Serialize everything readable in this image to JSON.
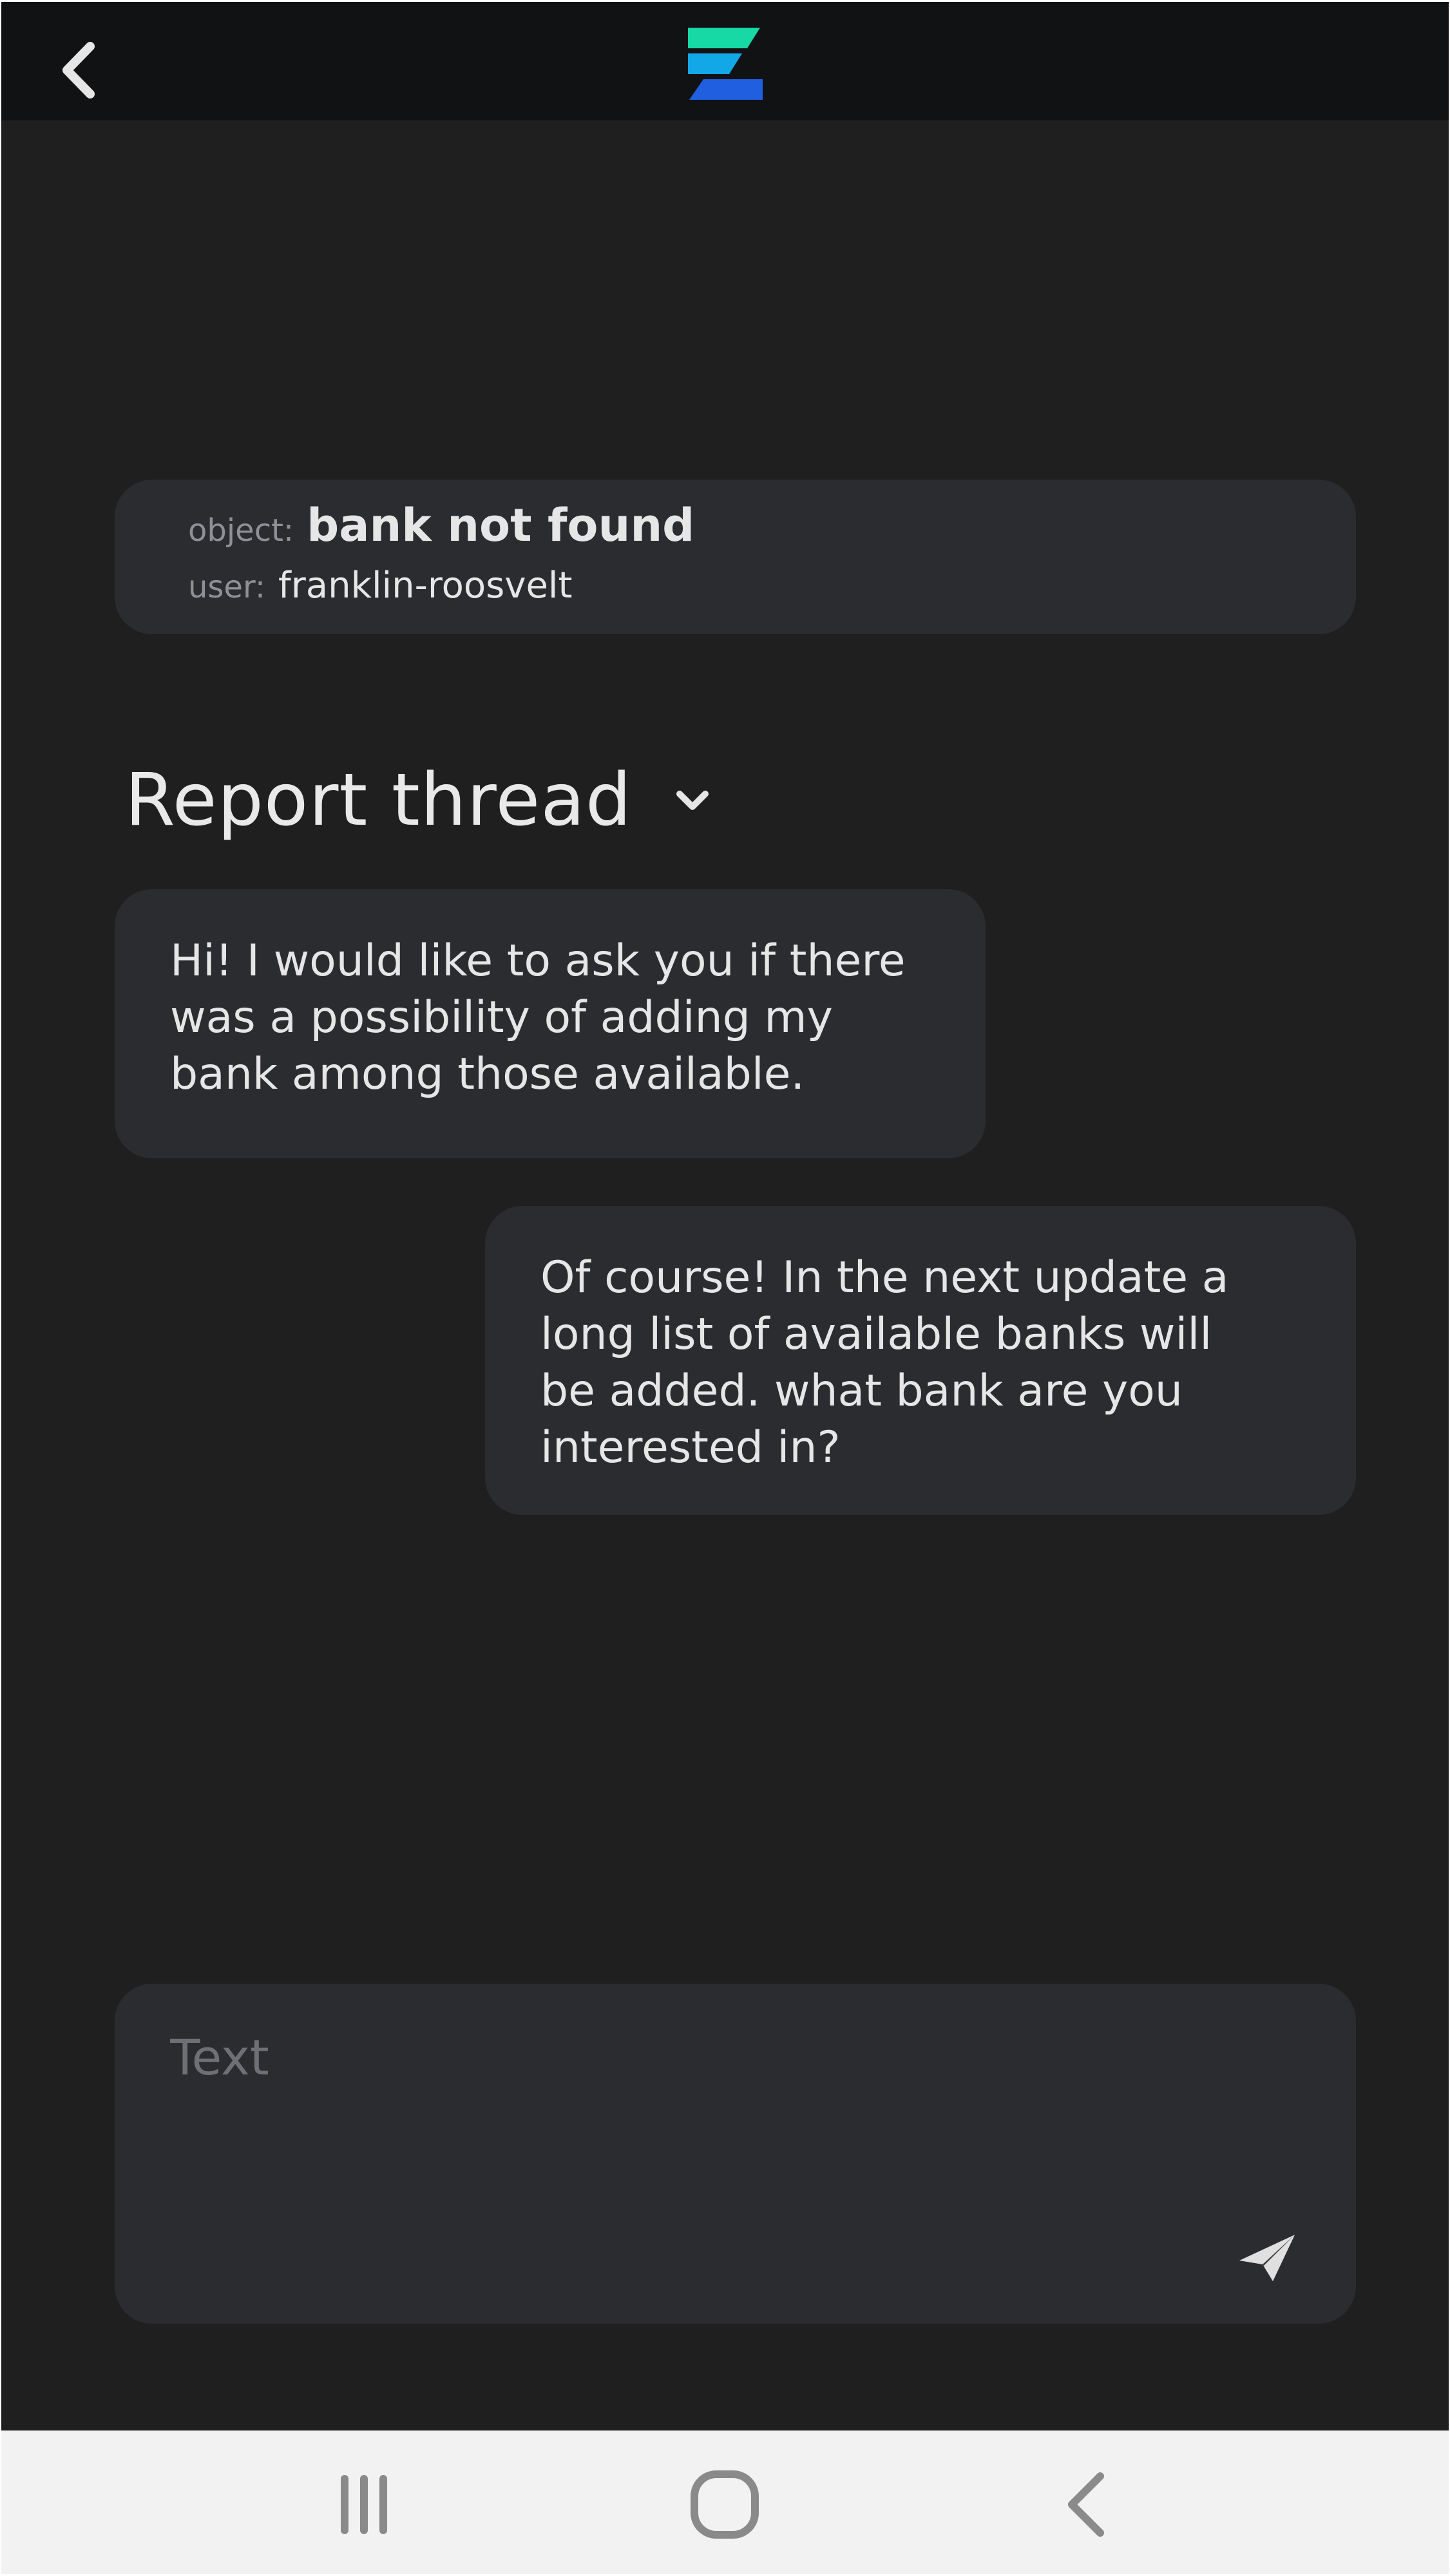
{
  "header": {
    "back_icon": "chevron-left-icon",
    "logo_icon": "app-logo-icon",
    "logo_colors": [
      "#16d9a5",
      "#12a8e8",
      "#1f5fe0"
    ]
  },
  "report": {
    "object_label": "object:",
    "object_value": "bank not found",
    "user_label": "user:",
    "user_value": "franklin-roosvelt"
  },
  "thread": {
    "title": "Report thread",
    "toggle_icon": "chevron-down-icon",
    "messages": [
      {
        "side": "left",
        "text": "Hi! I would like to ask you if there\nwas a possibility of adding my\nbank among those available."
      },
      {
        "side": "right",
        "text": "Of course! In the next update  a\nlong list of available banks will\nbe added. what bank are you\ninterested in?"
      }
    ]
  },
  "composer": {
    "placeholder": "Text",
    "value": "",
    "send_icon": "send-icon"
  },
  "system_nav": {
    "recents_icon": "recent-apps-icon",
    "home_icon": "home-icon",
    "back_icon": "back-icon"
  },
  "colors": {
    "background": "#1f1f1f",
    "topbar": "#111214",
    "card": "#2b2c30",
    "text": "#e6e6e6",
    "muted": "#8f9095",
    "navbar": "#f2f2f2"
  }
}
